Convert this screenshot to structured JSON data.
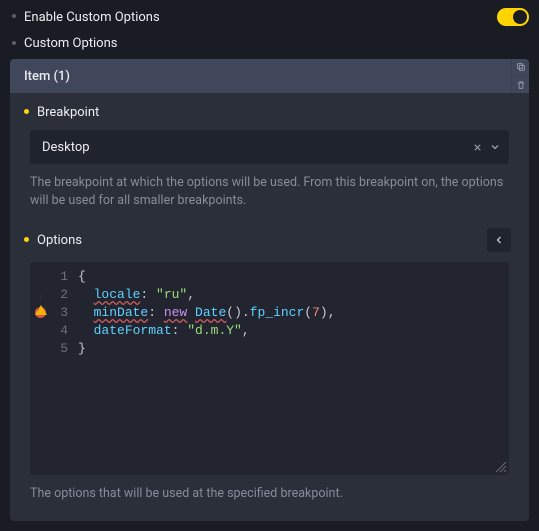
{
  "header": {
    "enable_label": "Enable Custom Options",
    "custom_options_label": "Custom Options"
  },
  "item": {
    "title": "Item (1)"
  },
  "breakpoint": {
    "label": "Breakpoint",
    "value": "Desktop",
    "help": "The breakpoint at which the options will be used. From this breakpoint on, the options will be used for all smaller breakpoints."
  },
  "options": {
    "label": "Options",
    "help": "The options that will be used at the specified breakpoint.",
    "lines": [
      "1",
      "2",
      "3",
      "4",
      "5"
    ],
    "code": {
      "l1_brace_open": "{",
      "l2_prop": "locale",
      "l2_colon": ": ",
      "l2_str": "\"ru\"",
      "l2_comma": ",",
      "l3_prop": "minDate",
      "l3_colon": ": ",
      "l3_kw": "new",
      "l3_sp": " ",
      "l3_cls": "Date",
      "l3_call": "().",
      "l3_fn": "fp_incr",
      "l3_p1": "(",
      "l3_num": "7",
      "l3_p2": "),",
      "l4_prop": "dateFormat",
      "l4_colon": ": ",
      "l4_str": "\"d.m.Y\"",
      "l4_comma": ",",
      "l5_brace_close": "}"
    }
  }
}
